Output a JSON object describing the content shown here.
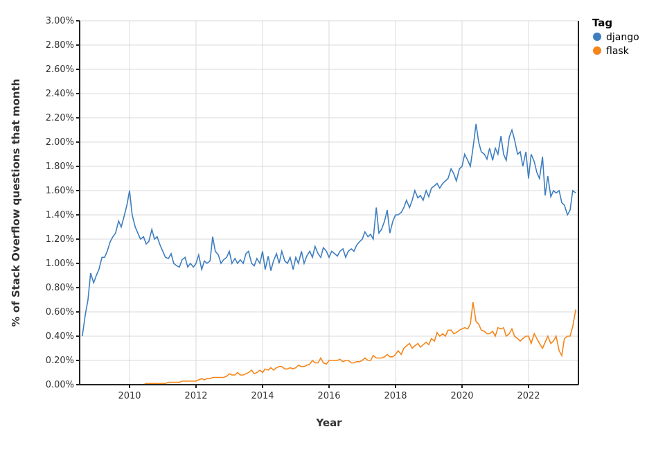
{
  "chart_data": {
    "type": "line",
    "xlabel": "Year",
    "ylabel": "% of Stack Overflow questions that month",
    "ylim": [
      0.0,
      3.0
    ],
    "xlim": [
      2008.5,
      2023.5
    ],
    "x_ticks": [
      2010,
      2012,
      2014,
      2016,
      2018,
      2020,
      2022
    ],
    "y_ticks": [
      0.0,
      0.2,
      0.4,
      0.6,
      0.8,
      1.0,
      1.2,
      1.4,
      1.6,
      1.8,
      2.0,
      2.2,
      2.4,
      2.6,
      2.8,
      3.0
    ],
    "y_tick_format": "0.00%",
    "legend_title": "Tag",
    "grid": true,
    "series": [
      {
        "name": "django",
        "color": "#3e7ebf",
        "x": [
          2008.58,
          2008.67,
          2008.75,
          2008.83,
          2008.92,
          2009.0,
          2009.08,
          2009.17,
          2009.25,
          2009.33,
          2009.42,
          2009.5,
          2009.58,
          2009.67,
          2009.75,
          2009.83,
          2009.92,
          2010.0,
          2010.08,
          2010.17,
          2010.25,
          2010.33,
          2010.42,
          2010.5,
          2010.58,
          2010.67,
          2010.75,
          2010.83,
          2010.92,
          2011.0,
          2011.08,
          2011.17,
          2011.25,
          2011.33,
          2011.42,
          2011.5,
          2011.58,
          2011.67,
          2011.75,
          2011.83,
          2011.92,
          2012.0,
          2012.08,
          2012.17,
          2012.25,
          2012.33,
          2012.42,
          2012.5,
          2012.58,
          2012.67,
          2012.75,
          2012.83,
          2012.92,
          2013.0,
          2013.08,
          2013.17,
          2013.25,
          2013.33,
          2013.42,
          2013.5,
          2013.58,
          2013.67,
          2013.75,
          2013.83,
          2013.92,
          2014.0,
          2014.08,
          2014.17,
          2014.25,
          2014.33,
          2014.42,
          2014.5,
          2014.58,
          2014.67,
          2014.75,
          2014.83,
          2014.92,
          2015.0,
          2015.08,
          2015.17,
          2015.25,
          2015.33,
          2015.42,
          2015.5,
          2015.58,
          2015.67,
          2015.75,
          2015.83,
          2015.92,
          2016.0,
          2016.08,
          2016.17,
          2016.25,
          2016.33,
          2016.42,
          2016.5,
          2016.58,
          2016.67,
          2016.75,
          2016.83,
          2016.92,
          2017.0,
          2017.08,
          2017.17,
          2017.25,
          2017.33,
          2017.42,
          2017.5,
          2017.58,
          2017.67,
          2017.75,
          2017.83,
          2017.92,
          2018.0,
          2018.08,
          2018.17,
          2018.25,
          2018.33,
          2018.42,
          2018.5,
          2018.58,
          2018.67,
          2018.75,
          2018.83,
          2018.92,
          2019.0,
          2019.08,
          2019.17,
          2019.25,
          2019.33,
          2019.42,
          2019.5,
          2019.58,
          2019.67,
          2019.75,
          2019.83,
          2019.92,
          2020.0,
          2020.08,
          2020.17,
          2020.25,
          2020.33,
          2020.42,
          2020.5,
          2020.58,
          2020.67,
          2020.75,
          2020.83,
          2020.92,
          2021.0,
          2021.08,
          2021.17,
          2021.25,
          2021.33,
          2021.42,
          2021.5,
          2021.58,
          2021.67,
          2021.75,
          2021.83,
          2021.92,
          2022.0,
          2022.08,
          2022.17,
          2022.25,
          2022.33,
          2022.42,
          2022.5,
          2022.58,
          2022.67,
          2022.75,
          2022.83,
          2022.92,
          2023.0,
          2023.08,
          2023.17,
          2023.25,
          2023.33,
          2023.42
        ],
        "y": [
          0.4,
          0.58,
          0.7,
          0.92,
          0.84,
          0.9,
          0.95,
          1.05,
          1.05,
          1.1,
          1.18,
          1.22,
          1.25,
          1.35,
          1.3,
          1.38,
          1.48,
          1.6,
          1.4,
          1.3,
          1.25,
          1.2,
          1.22,
          1.16,
          1.18,
          1.28,
          1.2,
          1.22,
          1.15,
          1.1,
          1.05,
          1.04,
          1.08,
          1.0,
          0.98,
          0.97,
          1.03,
          1.05,
          0.97,
          1.0,
          0.97,
          1.0,
          1.07,
          0.95,
          1.02,
          1.0,
          1.02,
          1.22,
          1.1,
          1.07,
          1.0,
          1.03,
          1.05,
          1.1,
          1.0,
          1.04,
          1.0,
          1.03,
          1.0,
          1.08,
          1.1,
          1.0,
          0.98,
          1.04,
          1.0,
          1.1,
          0.95,
          1.06,
          0.94,
          1.02,
          1.08,
          1.0,
          1.1,
          1.02,
          1.0,
          1.05,
          0.95,
          1.05,
          1.0,
          1.1,
          1.0,
          1.06,
          1.1,
          1.05,
          1.14,
          1.08,
          1.05,
          1.13,
          1.1,
          1.05,
          1.1,
          1.08,
          1.06,
          1.1,
          1.12,
          1.05,
          1.1,
          1.12,
          1.1,
          1.15,
          1.18,
          1.2,
          1.26,
          1.22,
          1.24,
          1.2,
          1.46,
          1.25,
          1.28,
          1.35,
          1.44,
          1.25,
          1.35,
          1.4,
          1.4,
          1.42,
          1.46,
          1.52,
          1.46,
          1.52,
          1.6,
          1.54,
          1.56,
          1.52,
          1.6,
          1.55,
          1.62,
          1.64,
          1.66,
          1.62,
          1.66,
          1.68,
          1.7,
          1.78,
          1.74,
          1.68,
          1.78,
          1.8,
          1.9,
          1.85,
          1.8,
          1.95,
          2.15,
          2.0,
          1.92,
          1.9,
          1.86,
          1.95,
          1.85,
          1.95,
          1.9,
          2.05,
          1.9,
          1.85,
          2.04,
          2.1,
          2.02,
          1.9,
          1.92,
          1.8,
          1.92,
          1.7,
          1.9,
          1.84,
          1.75,
          1.7,
          1.88,
          1.56,
          1.72,
          1.55,
          1.6,
          1.58,
          1.6,
          1.5,
          1.48,
          1.4,
          1.44,
          1.6,
          1.58
        ]
      },
      {
        "name": "flask",
        "color": "#f58518",
        "x": [
          2008.58,
          2008.67,
          2008.75,
          2008.83,
          2008.92,
          2009.0,
          2009.08,
          2009.17,
          2009.25,
          2009.33,
          2009.42,
          2009.5,
          2009.58,
          2009.67,
          2009.75,
          2009.83,
          2009.92,
          2010.0,
          2010.08,
          2010.17,
          2010.25,
          2010.33,
          2010.42,
          2010.5,
          2010.58,
          2010.67,
          2010.75,
          2010.83,
          2010.92,
          2011.0,
          2011.08,
          2011.17,
          2011.25,
          2011.33,
          2011.42,
          2011.5,
          2011.58,
          2011.67,
          2011.75,
          2011.83,
          2011.92,
          2012.0,
          2012.08,
          2012.17,
          2012.25,
          2012.33,
          2012.42,
          2012.5,
          2012.58,
          2012.67,
          2012.75,
          2012.83,
          2012.92,
          2013.0,
          2013.08,
          2013.17,
          2013.25,
          2013.33,
          2013.42,
          2013.5,
          2013.58,
          2013.67,
          2013.75,
          2013.83,
          2013.92,
          2014.0,
          2014.08,
          2014.17,
          2014.25,
          2014.33,
          2014.42,
          2014.5,
          2014.58,
          2014.67,
          2014.75,
          2014.83,
          2014.92,
          2015.0,
          2015.08,
          2015.17,
          2015.25,
          2015.33,
          2015.42,
          2015.5,
          2015.58,
          2015.67,
          2015.75,
          2015.83,
          2015.92,
          2016.0,
          2016.08,
          2016.17,
          2016.25,
          2016.33,
          2016.42,
          2016.5,
          2016.58,
          2016.67,
          2016.75,
          2016.83,
          2016.92,
          2017.0,
          2017.08,
          2017.17,
          2017.25,
          2017.33,
          2017.42,
          2017.5,
          2017.58,
          2017.67,
          2017.75,
          2017.83,
          2017.92,
          2018.0,
          2018.08,
          2018.17,
          2018.25,
          2018.33,
          2018.42,
          2018.5,
          2018.58,
          2018.67,
          2018.75,
          2018.83,
          2018.92,
          2019.0,
          2019.08,
          2019.17,
          2019.25,
          2019.33,
          2019.42,
          2019.5,
          2019.58,
          2019.67,
          2019.75,
          2019.83,
          2019.92,
          2020.0,
          2020.08,
          2020.17,
          2020.25,
          2020.33,
          2020.42,
          2020.5,
          2020.58,
          2020.67,
          2020.75,
          2020.83,
          2020.92,
          2021.0,
          2021.08,
          2021.17,
          2021.25,
          2021.33,
          2021.42,
          2021.5,
          2021.58,
          2021.67,
          2021.75,
          2021.83,
          2021.92,
          2022.0,
          2022.08,
          2022.17,
          2022.25,
          2022.33,
          2022.42,
          2022.5,
          2022.58,
          2022.67,
          2022.75,
          2022.83,
          2022.92,
          2023.0,
          2023.08,
          2023.17,
          2023.25,
          2023.33,
          2023.42
        ],
        "y": [
          0,
          0,
          0,
          0,
          0,
          0,
          0,
          0,
          0,
          0,
          0,
          0,
          0,
          0,
          0,
          0,
          0,
          0,
          0,
          0,
          0.0,
          0.0,
          0.0,
          0.01,
          0.01,
          0.01,
          0.01,
          0.01,
          0.01,
          0.01,
          0.01,
          0.02,
          0.02,
          0.02,
          0.02,
          0.02,
          0.03,
          0.03,
          0.03,
          0.03,
          0.03,
          0.03,
          0.04,
          0.05,
          0.04,
          0.05,
          0.05,
          0.06,
          0.06,
          0.06,
          0.06,
          0.06,
          0.07,
          0.09,
          0.08,
          0.08,
          0.1,
          0.08,
          0.08,
          0.09,
          0.1,
          0.12,
          0.09,
          0.1,
          0.12,
          0.1,
          0.13,
          0.12,
          0.14,
          0.12,
          0.14,
          0.15,
          0.15,
          0.13,
          0.13,
          0.14,
          0.13,
          0.14,
          0.16,
          0.15,
          0.15,
          0.16,
          0.17,
          0.2,
          0.18,
          0.18,
          0.22,
          0.18,
          0.17,
          0.2,
          0.2,
          0.2,
          0.2,
          0.21,
          0.19,
          0.2,
          0.2,
          0.18,
          0.18,
          0.19,
          0.19,
          0.2,
          0.22,
          0.2,
          0.2,
          0.24,
          0.22,
          0.22,
          0.22,
          0.23,
          0.25,
          0.23,
          0.23,
          0.25,
          0.28,
          0.25,
          0.3,
          0.32,
          0.34,
          0.3,
          0.32,
          0.34,
          0.31,
          0.33,
          0.35,
          0.33,
          0.38,
          0.36,
          0.43,
          0.4,
          0.42,
          0.4,
          0.45,
          0.45,
          0.42,
          0.43,
          0.45,
          0.46,
          0.47,
          0.46,
          0.5,
          0.68,
          0.52,
          0.5,
          0.45,
          0.44,
          0.42,
          0.42,
          0.44,
          0.4,
          0.47,
          0.46,
          0.47,
          0.4,
          0.42,
          0.46,
          0.4,
          0.38,
          0.36,
          0.38,
          0.4,
          0.4,
          0.34,
          0.42,
          0.38,
          0.34,
          0.3,
          0.35,
          0.4,
          0.34,
          0.36,
          0.4,
          0.28,
          0.24,
          0.38,
          0.4,
          0.4,
          0.48,
          0.62
        ]
      }
    ]
  }
}
